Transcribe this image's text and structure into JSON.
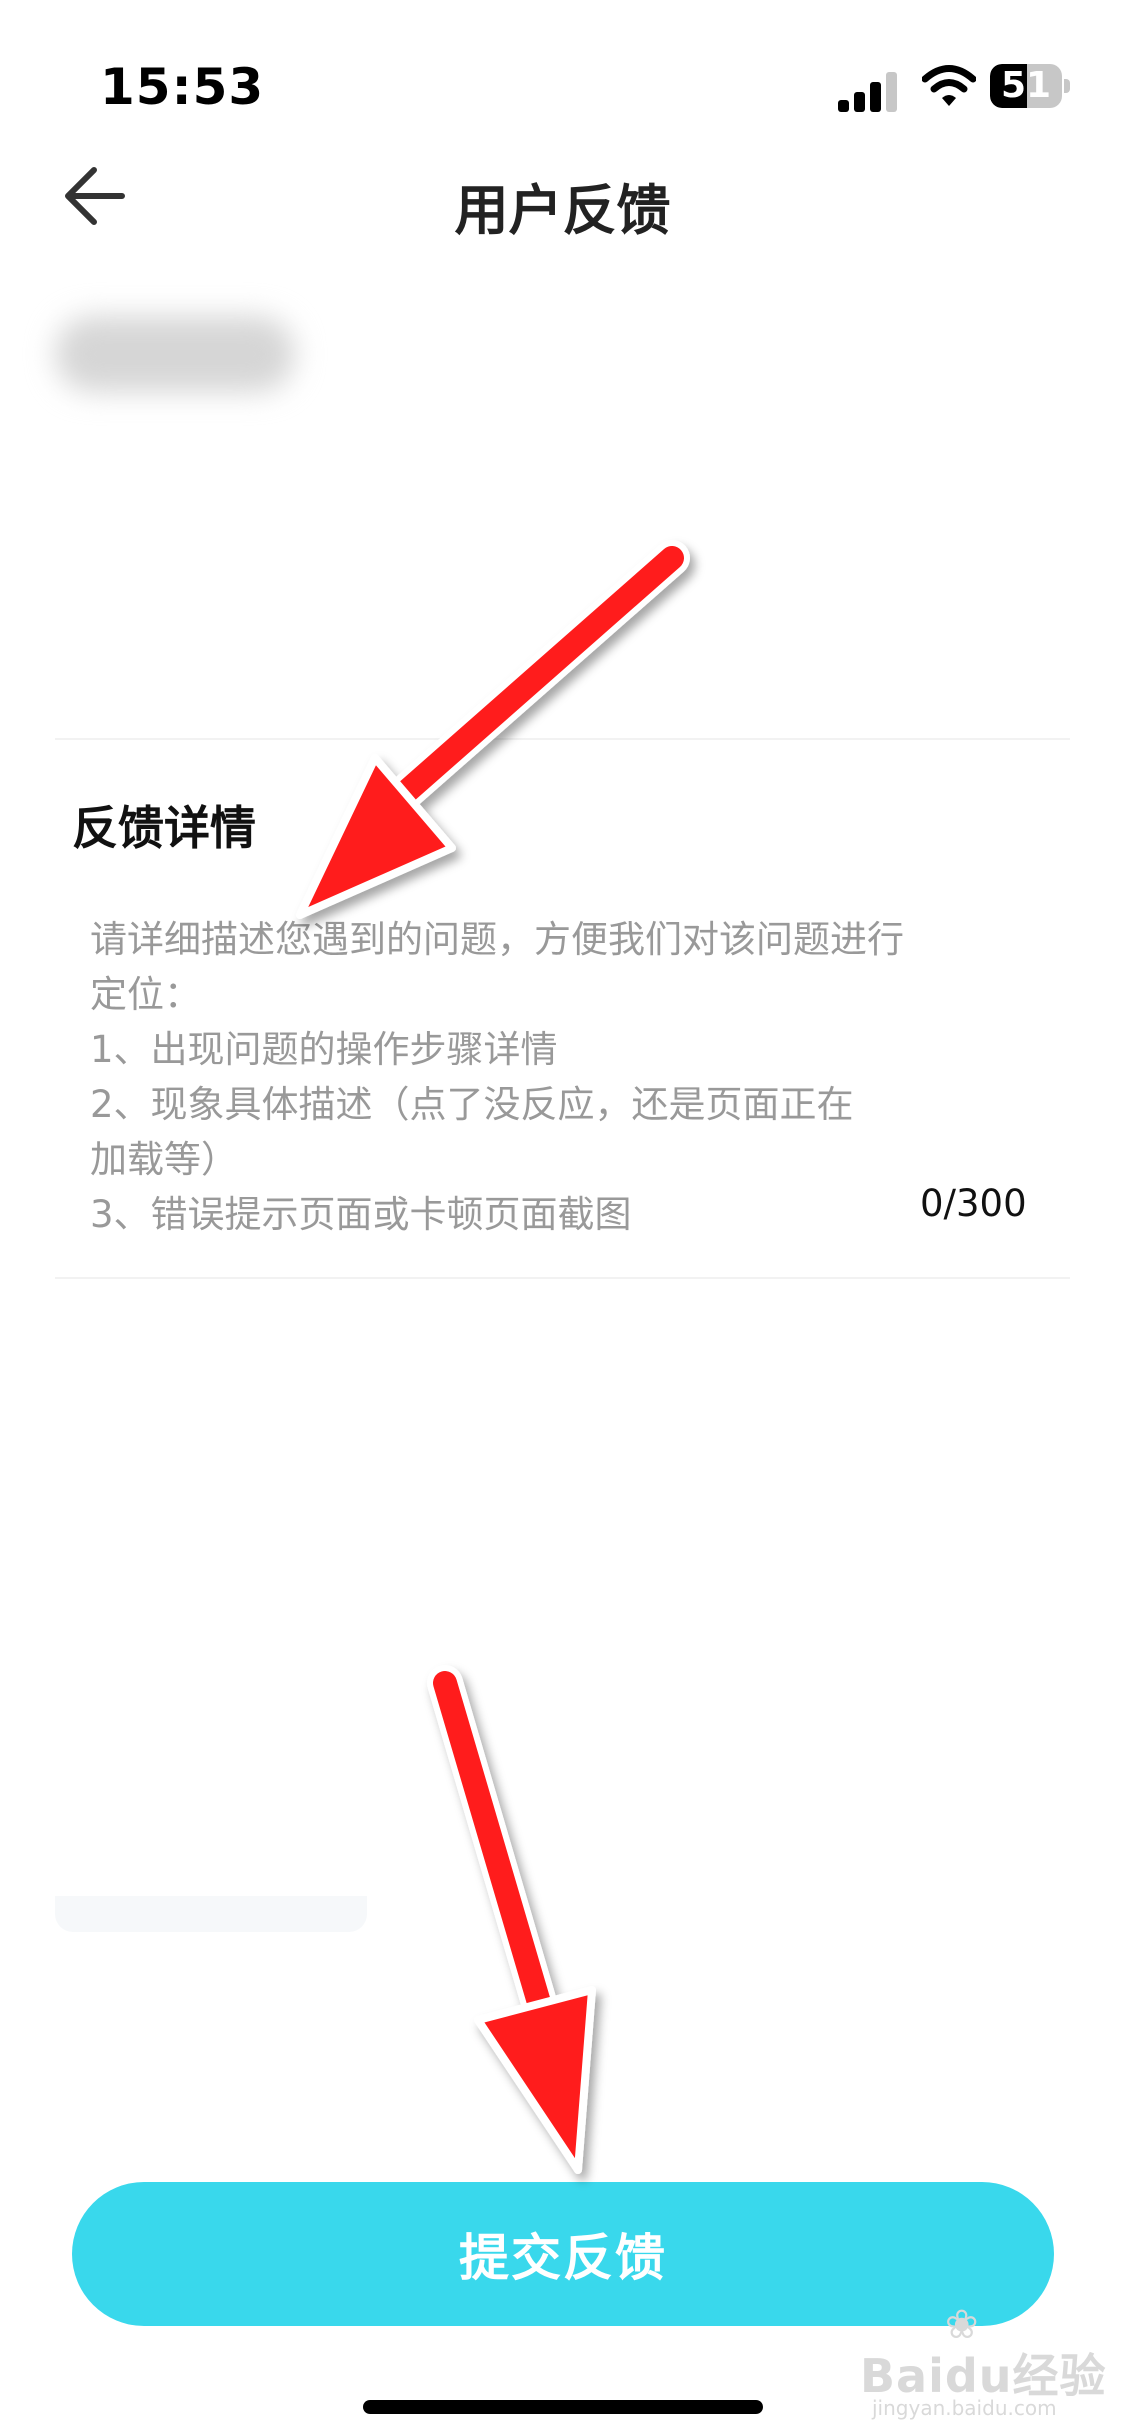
{
  "status_bar": {
    "time": "15:53",
    "battery_level": "51",
    "icons": [
      "signal-icon",
      "wifi-icon",
      "battery-icon"
    ]
  },
  "nav": {
    "back_icon": "back-arrow-icon",
    "title": "用户反馈"
  },
  "feedback": {
    "section_title": "反馈详情",
    "placeholder": "请详细描述您遇到的问题，方便我们对该问题进行\n定位：\n1、出现问题的操作步骤详情\n2、现象具体描述（点了没反应，还是页面正在\n加载等）\n3、错误提示页面或卡顿页面截图",
    "counter": "0/300"
  },
  "submit": {
    "label": "提交反馈"
  },
  "watermark": {
    "logo": "Baidu经验",
    "url": "jingyan.baidu.com"
  },
  "colors": {
    "accent": "#39d8ec",
    "annotation_arrow": "#ff1a1a",
    "placeholder_text": "#999999"
  }
}
